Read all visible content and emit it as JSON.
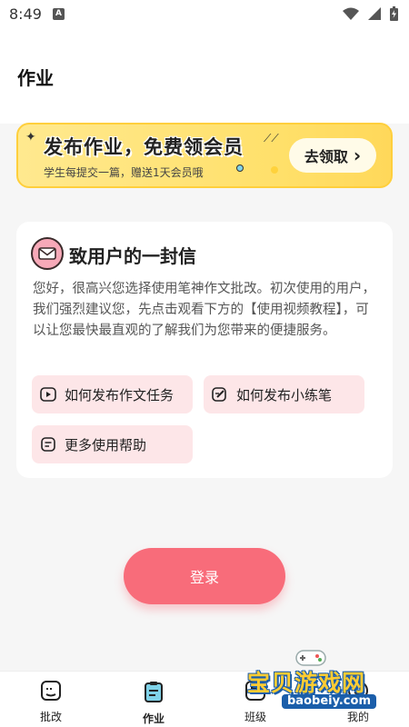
{
  "status_bar": {
    "time": "8:49",
    "notification_badge": "A"
  },
  "header": {
    "title": "作业"
  },
  "promo": {
    "title": "发布作业，免费领会员",
    "subtitle": "学生每提交一篇，赠送1天会员哦",
    "button_label": "去领取",
    "chevron": "›"
  },
  "letter": {
    "title": "致用户的一封信",
    "body": "您好，很高兴您选择使用笔神作文批改。初次使用的用户，我们强烈建议您，先点击观看下方的【使用视频教程】，可以让您最快最直观的了解我们为您带来的便捷服务。",
    "buttons": [
      {
        "label": "如何发布作文任务",
        "icon": "video-icon"
      },
      {
        "label": "如何发布小练笔",
        "icon": "edit-icon"
      },
      {
        "label": "更多使用帮助",
        "icon": "document-icon"
      }
    ]
  },
  "login": {
    "label": "登录"
  },
  "tabs": [
    {
      "label": "批改",
      "icon": "grading-icon",
      "active": false
    },
    {
      "label": "作业",
      "icon": "homework-icon",
      "active": true
    },
    {
      "label": "班级",
      "icon": "class-icon",
      "active": false
    },
    {
      "label": "我的",
      "icon": "profile-icon",
      "active": false
    }
  ],
  "watermark": {
    "text": "宝贝游戏网",
    "url": "baobeiy.com"
  },
  "colors": {
    "accent": "#f86c7a",
    "promo_yellow": "#ffe06a",
    "help_bg": "#fde6e8",
    "active_tab": "#7fd2e8"
  }
}
